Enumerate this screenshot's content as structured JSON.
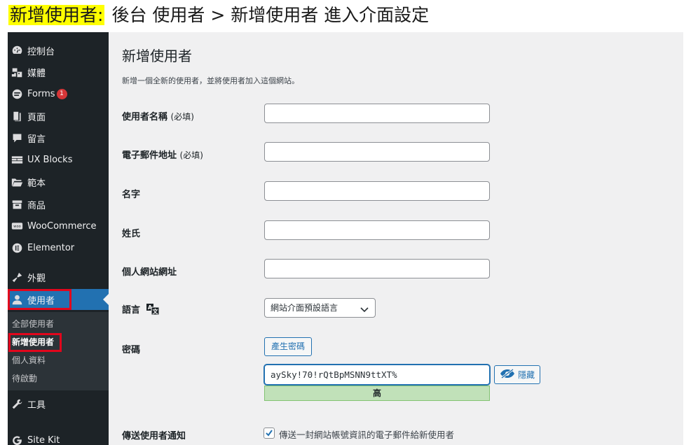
{
  "caption": {
    "highlight": "新增使用者:",
    "rest": "後台  使用者 > 新增使用者  進入介面設定"
  },
  "sidebar": {
    "items": [
      {
        "label": "控制台",
        "icon": "dashboard-icon"
      },
      {
        "label": "媒體",
        "icon": "media-icon"
      },
      {
        "label": "Forms",
        "icon": "forms-icon",
        "badge": "1"
      },
      {
        "label": "頁面",
        "icon": "pages-icon"
      },
      {
        "label": "留言",
        "icon": "comments-icon"
      },
      {
        "label": "UX Blocks",
        "icon": "ux-blocks-icon"
      },
      {
        "label": "範本",
        "icon": "templates-icon"
      },
      {
        "label": "商品",
        "icon": "products-icon"
      },
      {
        "label": "WooCommerce",
        "icon": "woocommerce-icon"
      },
      {
        "label": "Elementor",
        "icon": "elementor-icon"
      },
      {
        "label": "外觀",
        "icon": "appearance-icon"
      },
      {
        "label": "使用者",
        "icon": "users-icon"
      },
      {
        "label": "工具",
        "icon": "tools-icon"
      },
      {
        "label": "Site Kit",
        "icon": "site-kit-icon"
      }
    ],
    "submenu": [
      "全部使用者",
      "新增使用者",
      "個人資料",
      "待啟動"
    ]
  },
  "colors": {
    "sidebar_bg": "#1d2327",
    "active_bg": "#2271b1",
    "highlight_red": "#e2061c",
    "strength_green": "#c1e1b9"
  },
  "main": {
    "title": "新增使用者",
    "description": "新增一個全新的使用者，並將使用者加入這個網站。",
    "fields": {
      "username": {
        "label": "使用者名稱",
        "note": "(必填)",
        "value": ""
      },
      "email": {
        "label": "電子郵件地址",
        "note": "(必填)",
        "value": ""
      },
      "first_name": {
        "label": "名字",
        "value": ""
      },
      "last_name": {
        "label": "姓氏",
        "value": ""
      },
      "website": {
        "label": "個人網站網址",
        "value": ""
      },
      "language": {
        "label": "語言",
        "selected": "網站介面預設語言"
      },
      "password": {
        "label": "密碼",
        "generate_button": "產生密碼",
        "value": "aySky!70!rQtBpMSNN9ttXT%",
        "hide_button": "隱藏",
        "strength": "高"
      },
      "notify": {
        "label": "傳送使用者通知",
        "checkbox_label": "傳送一封網站帳號資訊的電子郵件給新使用者",
        "checked": true
      }
    }
  }
}
